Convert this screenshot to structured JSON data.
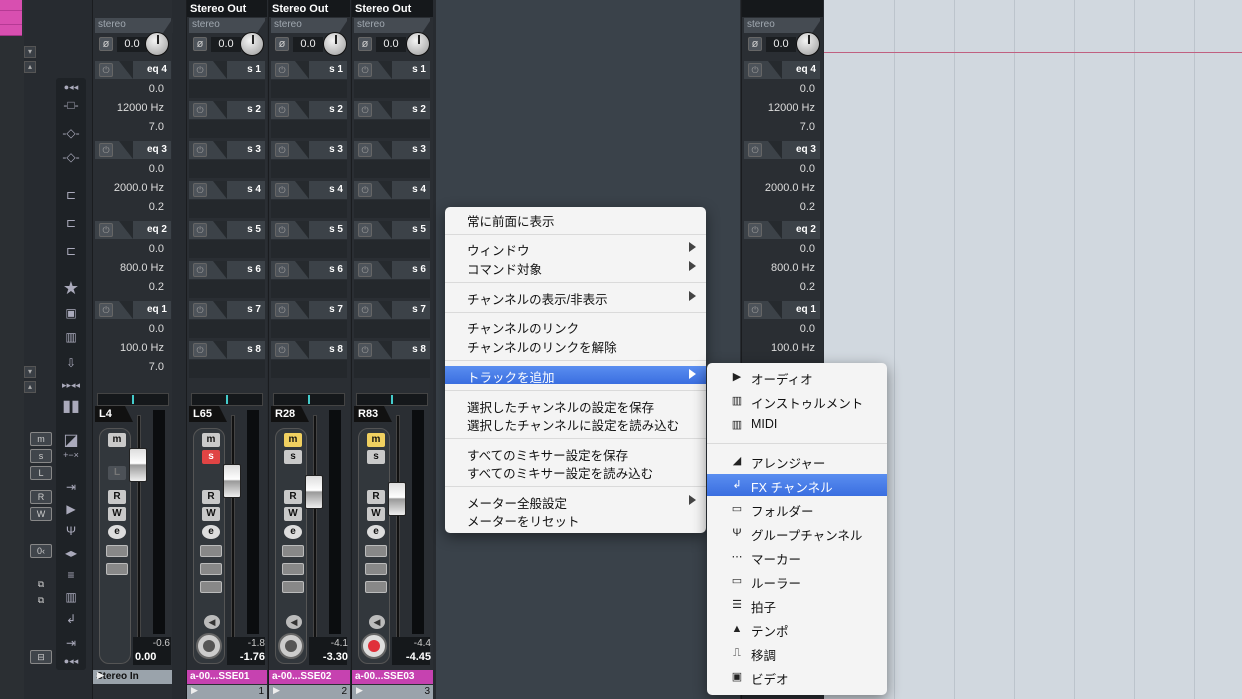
{
  "channels": [
    {
      "header": "Stereo Out",
      "stereo": "stereo",
      "pan_value": "0.0",
      "name": "L65",
      "peak": "-1.8",
      "level": "-1.76",
      "track_name": "a-00...SSE01",
      "track_number": "1",
      "mute_on": false,
      "solo_on": true,
      "record_on": false
    },
    {
      "header": "Stereo Out",
      "stereo": "stereo",
      "pan_value": "0.0",
      "name": "R28",
      "peak": "-4.1",
      "level": "-3.30",
      "track_name": "a-00...SSE02",
      "track_number": "2",
      "mute_on": true,
      "solo_on": false,
      "record_on": false
    },
    {
      "header": "Stereo Out",
      "stereo": "stereo",
      "pan_value": "0.0",
      "name": "R83",
      "peak": "-4.4",
      "level": "-4.45",
      "track_name": "a-00...SSE03",
      "track_number": "3",
      "mute_on": true,
      "solo_on": false,
      "record_on": true
    }
  ],
  "sends": [
    "s 1",
    "s 2",
    "s 3",
    "s 4",
    "s 5",
    "s 6",
    "s 7",
    "s 8"
  ],
  "input_channel": {
    "stereo": "stereo",
    "pan_value": "0.0",
    "name": "L4",
    "peak": "-0.6",
    "level": "0.00",
    "footer": "Stereo In",
    "eq": [
      {
        "label": "eq 4",
        "gain": "0.0",
        "freq": "12000 Hz",
        "q": "7.0"
      },
      {
        "label": "eq 3",
        "gain": "0.0",
        "freq": "2000.0 Hz",
        "q": "0.2"
      },
      {
        "label": "eq 2",
        "gain": "0.0",
        "freq": "800.0 Hz",
        "q": "0.2"
      },
      {
        "label": "eq 1",
        "gain": "0.0",
        "freq": "100.0 Hz",
        "q": "7.0"
      }
    ]
  },
  "right_channel": {
    "stereo": "stereo",
    "pan_value": "0.0"
  },
  "buttons": {
    "m": "m",
    "s": "s",
    "l": "L",
    "r": "R",
    "w": "W",
    "e": "e"
  },
  "context_menu": {
    "items": [
      {
        "label": "常に前面に表示"
      },
      {
        "label": "ウィンドウ"
      },
      {
        "label": "コマンド対象"
      },
      {
        "label": "チャンネルの表示/非表示"
      },
      {
        "label": "チャンネルのリンク"
      },
      {
        "label": "チャンネルのリンクを解除"
      },
      {
        "label": "トラックを追加"
      },
      {
        "label": "選択したチャンネルの設定を保存"
      },
      {
        "label": "選択したチャンネルに設定を読み込む"
      },
      {
        "label": "すべてのミキサー設定を保存"
      },
      {
        "label": "すべてのミキサー設定を読み込む"
      },
      {
        "label": "メーター全般設定"
      },
      {
        "label": "メーターをリセット"
      }
    ]
  },
  "submenu": {
    "items": [
      {
        "label": "オーディオ",
        "icon": "play-icon"
      },
      {
        "label": "インストゥルメント",
        "icon": "instrument-icon"
      },
      {
        "label": "MIDI",
        "icon": "midi-icon"
      },
      {
        "label": "アレンジャー",
        "icon": "arranger-icon"
      },
      {
        "label": "FX チャンネル",
        "icon": "fx-channel-icon"
      },
      {
        "label": "フォルダー",
        "icon": "folder-icon"
      },
      {
        "label": "グループチャンネル",
        "icon": "group-channel-icon"
      },
      {
        "label": "マーカー",
        "icon": "marker-icon"
      },
      {
        "label": "ルーラー",
        "icon": "ruler-icon"
      },
      {
        "label": "拍子",
        "icon": "signature-icon"
      },
      {
        "label": "テンポ",
        "icon": "tempo-icon"
      },
      {
        "label": "移調",
        "icon": "transpose-icon"
      },
      {
        "label": "ビデオ",
        "icon": "video-icon"
      }
    ]
  },
  "colors": {
    "accent": "#3a6ee0",
    "track_pink": "#c642b0",
    "mute": "#f0d060",
    "solo": "#e04444",
    "record": "#e0303a"
  }
}
